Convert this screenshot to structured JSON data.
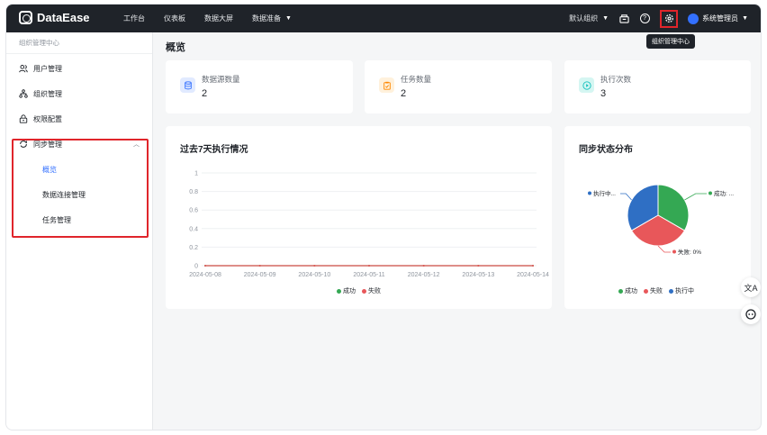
{
  "brand": {
    "name": "DataEase"
  },
  "nav": {
    "workbench": "工作台",
    "dashboard": "仪表板",
    "screen": "数据大屏",
    "prepare": "数据准备"
  },
  "header": {
    "org": "默认组织",
    "user": "系统管理员",
    "tooltip": "组织管理中心"
  },
  "sidebar": {
    "title": "组织管理中心",
    "items": [
      {
        "label": "用户管理"
      },
      {
        "label": "组织管理"
      },
      {
        "label": "权限配置"
      },
      {
        "label": "同步管理"
      }
    ],
    "sub": [
      {
        "label": "概览"
      },
      {
        "label": "数据连接管理"
      },
      {
        "label": "任务管理"
      }
    ]
  },
  "page": {
    "title": "概览"
  },
  "stats": [
    {
      "label": "数据源数量",
      "value": "2",
      "icon": "database-icon",
      "color": "#3370ff"
    },
    {
      "label": "任务数量",
      "value": "2",
      "icon": "task-icon",
      "color": "#ff8800"
    },
    {
      "label": "执行次数",
      "value": "3",
      "icon": "play-icon",
      "color": "#14c0bd"
    }
  ],
  "line_card": {
    "title": "过去7天执行情况"
  },
  "pie_card": {
    "title": "同步状态分布"
  },
  "colors": {
    "success": "#34a853",
    "fail": "#e8575a",
    "running": "#2f6fc4",
    "accent": "#3370ff",
    "red_highlight": "#e0252b"
  },
  "chart_data": [
    {
      "type": "line",
      "title": "过去7天执行情况",
      "x": [
        "2024-05-08",
        "2024-05-09",
        "2024-05-10",
        "2024-05-11",
        "2024-05-12",
        "2024-05-13",
        "2024-05-14"
      ],
      "yticks": [
        "0",
        "0.2",
        "0.4",
        "0.6",
        "0.8",
        "1"
      ],
      "ylim": [
        0,
        1
      ],
      "series": [
        {
          "name": "成功",
          "values": [
            0,
            0,
            0,
            0,
            0,
            0,
            0
          ],
          "color": "#34a853"
        },
        {
          "name": "失败",
          "values": [
            0,
            0,
            0,
            0,
            0,
            0,
            0
          ],
          "color": "#e8575a"
        }
      ],
      "legend": "bottom"
    },
    {
      "type": "pie",
      "title": "同步状态分布",
      "labels": [
        "成功",
        "失败",
        "执行中"
      ],
      "values": [
        33.3,
        33.3,
        33.3
      ],
      "slice_labels": [
        "成功: ...",
        "失败: 0%",
        "执行中..."
      ],
      "colors": [
        "#34a853",
        "#e8575a",
        "#2f6fc4"
      ],
      "legend": "bottom"
    }
  ]
}
